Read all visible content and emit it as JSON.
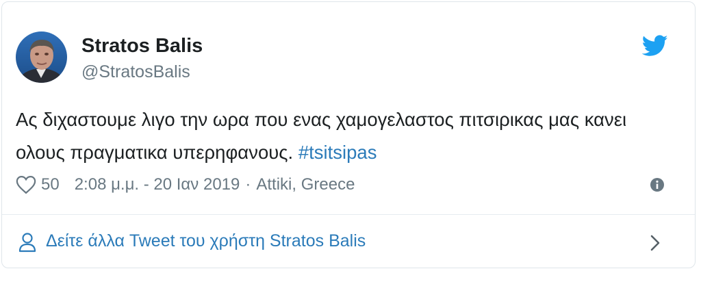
{
  "author": {
    "name": "Stratos Balis",
    "handle": "@StratosBalis"
  },
  "tweet": {
    "text": "Ας διχαστουμε λιγο την ωρα που ενας χαμογελαστος πιτσιρικας μας κανει ολους πραγματικα υπερηφανους.",
    "hashtag": "#tsitsipas"
  },
  "meta": {
    "likes": "50",
    "timestamp": "2:08 μ.μ. - 20 Ιαν 2019",
    "separator": "·",
    "location": "Attiki, Greece"
  },
  "footer": {
    "label": "Δείτε άλλα Tweet του χρήστη Stratos Balis"
  },
  "icons": {
    "bird": "twitter-bird-icon",
    "heart": "heart-icon",
    "info": "info-icon",
    "person": "person-icon",
    "chevron": "chevron-right-icon"
  },
  "colors": {
    "link": "#2b7bb9",
    "bird": "#1da1f2",
    "muted": "#697882",
    "text": "#1c2022"
  }
}
